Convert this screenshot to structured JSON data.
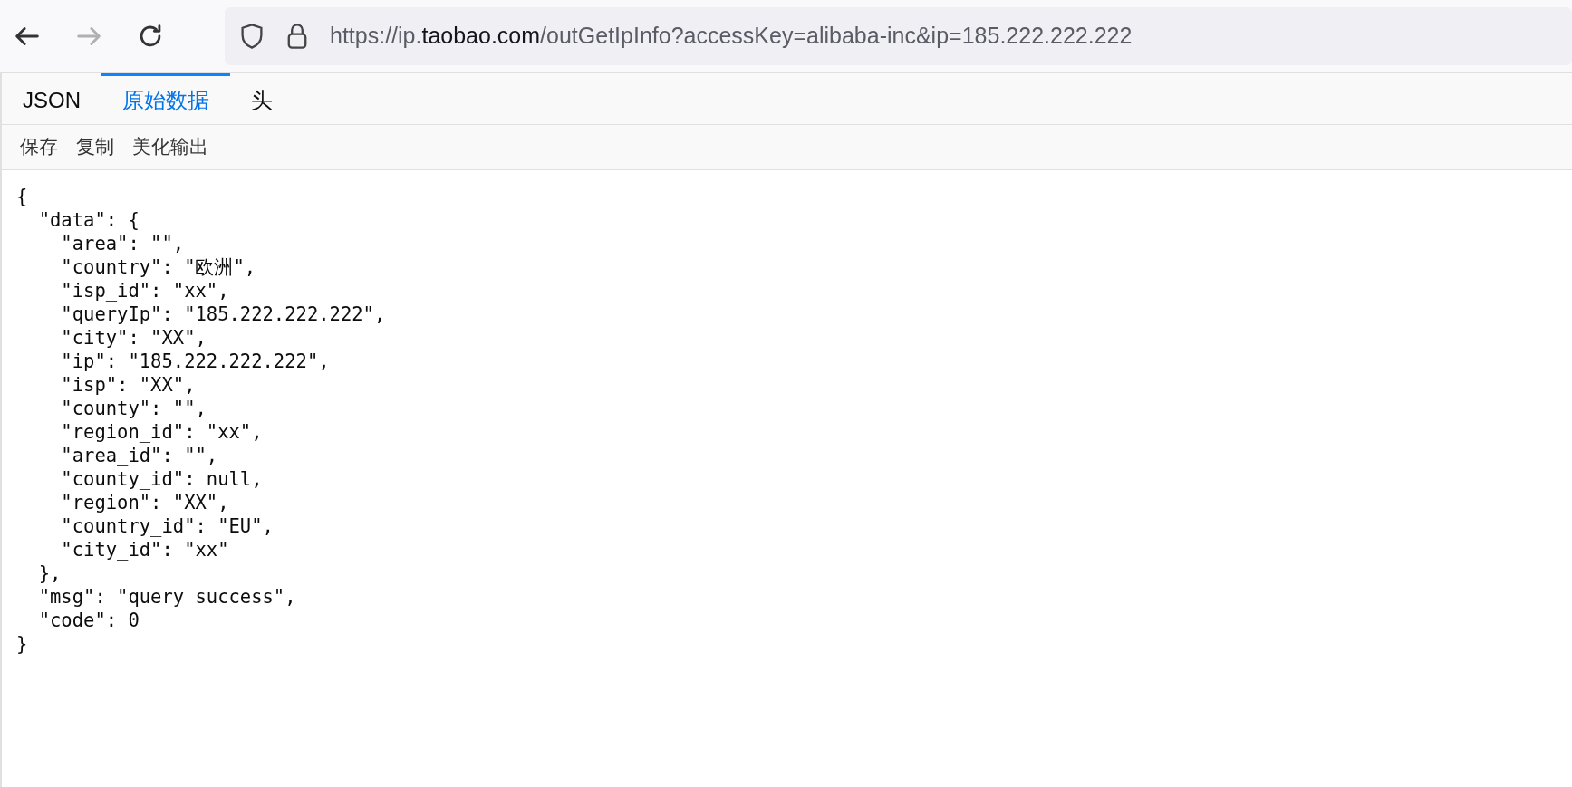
{
  "browser": {
    "back_disabled": false,
    "forward_disabled": true,
    "url_parts": [
      {
        "text": "https://ip.",
        "highlight": false
      },
      {
        "text": "taobao.com",
        "highlight": true
      },
      {
        "text": "/outGetIpInfo?accessKey=alibaba-inc&ip=185.222.222.222",
        "highlight": false
      }
    ]
  },
  "tabs": [
    {
      "label": "JSON",
      "selected": false
    },
    {
      "label": "原始数据",
      "selected": true
    },
    {
      "label": "头",
      "selected": false
    }
  ],
  "actions": [
    "保存",
    "复制",
    "美化输出"
  ],
  "raw_lines": [
    "{",
    "  \"data\": {",
    "    \"area\": \"\",",
    "    \"country\": \"欧洲\",",
    "    \"isp_id\": \"xx\",",
    "    \"queryIp\": \"185.222.222.222\",",
    "    \"city\": \"XX\",",
    "    \"ip\": \"185.222.222.222\",",
    "    \"isp\": \"XX\",",
    "    \"county\": \"\",",
    "    \"region_id\": \"xx\",",
    "    \"area_id\": \"\",",
    "    \"county_id\": null,",
    "    \"region\": \"XX\",",
    "    \"country_id\": \"EU\",",
    "    \"city_id\": \"xx\"",
    "  },",
    "  \"msg\": \"query success\",",
    "  \"code\": 0",
    "}"
  ]
}
